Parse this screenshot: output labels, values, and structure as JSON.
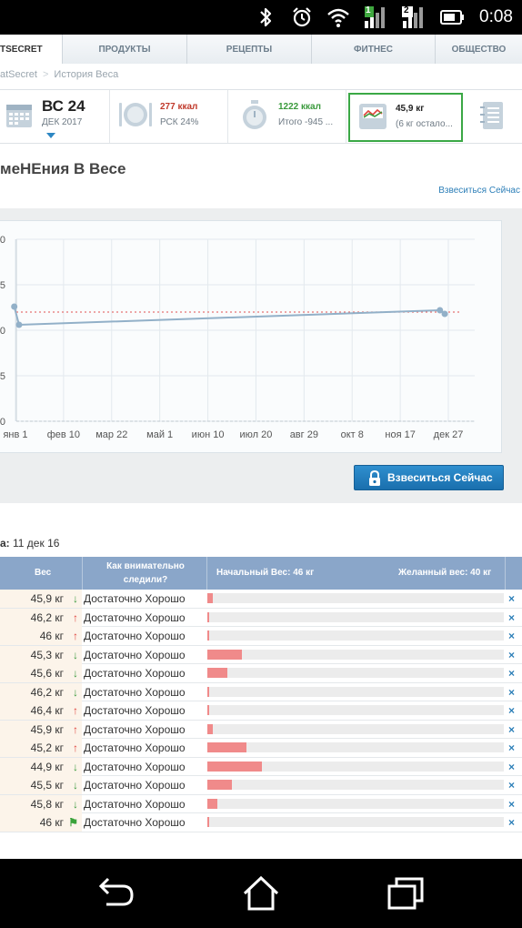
{
  "status_bar": {
    "time": "0:08",
    "icons": [
      "bluetooth-icon",
      "alarm-icon",
      "wifi-icon",
      "signal-1-icon",
      "signal-2-icon",
      "battery-icon"
    ],
    "sim1_label": "1",
    "sim2_label": "2"
  },
  "tabs": [
    {
      "label": "TSECRET",
      "active": true
    },
    {
      "label": "ПРОДУКТЫ",
      "active": false
    },
    {
      "label": "РЕЦЕПТЫ",
      "active": false
    },
    {
      "label": "ФИТНЕС",
      "active": false
    },
    {
      "label": "ОБЩЕСТВО",
      "active": false
    }
  ],
  "breadcrumb": {
    "root": "atSecret",
    "current": "История Веса"
  },
  "summary": {
    "date_day": "ВС 24",
    "date_month": "ДЕК 2017",
    "food_kcal": "277 ккал",
    "food_rsk": "РСК 24%",
    "exercise_kcal": "1222 ккал",
    "exercise_total": "Итого -945 ...",
    "weight_value": "45,9 кг",
    "weight_left": "(6 кг остало...",
    "colors": {
      "food": "#c0392b",
      "exercise": "#3a9a3c",
      "weight_border": "#3aa845"
    }
  },
  "page": {
    "title": "меНЕния В Весе",
    "weigh_link": "Взвеситься Сейчас",
    "weigh_button": "Взвеситься Сейчас",
    "since_label": "а:",
    "since_value": "11 дек 16"
  },
  "chart_data": {
    "type": "line",
    "x_ticks": [
      "янв 1",
      "фев 10",
      "мар 22",
      "май 1",
      "июн 10",
      "июл 20",
      "авг 29",
      "окт 8",
      "ноя 17",
      "дек 27"
    ],
    "y_ticks": [
      "0",
      "5",
      "0",
      "5",
      "0"
    ],
    "ylim": [
      40,
      50
    ],
    "goal_line": 46,
    "series": [
      {
        "points": [
          {
            "x": "2016-12-31",
            "y": 46.3
          },
          {
            "x": "2017-01-04",
            "y": 45.3
          },
          {
            "x": "2017-12-20",
            "y": 46.1
          },
          {
            "x": "2017-12-24",
            "y": 45.9
          }
        ]
      }
    ],
    "grid": true
  },
  "table": {
    "headers": {
      "weight": "Вес",
      "attention": "Как внимательно следили?",
      "start": "Начальный Вес: 46 кг",
      "goal": "Желанный вес: 40 кг"
    },
    "rows": [
      {
        "weight": "45,9 кг",
        "trend": "down",
        "quality": "Достаточно Хорошо",
        "progress": 0.017
      },
      {
        "weight": "46,2 кг",
        "trend": "up",
        "quality": "Достаточно Хорошо",
        "progress": 0.005
      },
      {
        "weight": "46 кг",
        "trend": "up",
        "quality": "Достаточно Хорошо",
        "progress": 0.005
      },
      {
        "weight": "45,3 кг",
        "trend": "down",
        "quality": "Достаточно Хорошо",
        "progress": 0.117
      },
      {
        "weight": "45,6 кг",
        "trend": "down",
        "quality": "Достаточно Хорошо",
        "progress": 0.067
      },
      {
        "weight": "46,2 кг",
        "trend": "down",
        "quality": "Достаточно Хорошо",
        "progress": 0.005
      },
      {
        "weight": "46,4 кг",
        "trend": "up",
        "quality": "Достаточно Хорошо",
        "progress": 0.005
      },
      {
        "weight": "45,9 кг",
        "trend": "up",
        "quality": "Достаточно Хорошо",
        "progress": 0.017
      },
      {
        "weight": "45,2 кг",
        "trend": "up",
        "quality": "Достаточно Хорошо",
        "progress": 0.133
      },
      {
        "weight": "44,9 кг",
        "trend": "down",
        "quality": "Достаточно Хорошо",
        "progress": 0.183
      },
      {
        "weight": "45,5 кг",
        "trend": "down",
        "quality": "Достаточно Хорошо",
        "progress": 0.083
      },
      {
        "weight": "45,8 кг",
        "trend": "down",
        "quality": "Достаточно Хорошо",
        "progress": 0.033
      },
      {
        "weight": "46 кг",
        "trend": "flag",
        "quality": "Достаточно Хорошо",
        "progress": 0.005
      }
    ],
    "delete_glyph": "×"
  },
  "navbar": {
    "buttons": [
      "back-icon",
      "home-icon",
      "recents-icon"
    ]
  }
}
